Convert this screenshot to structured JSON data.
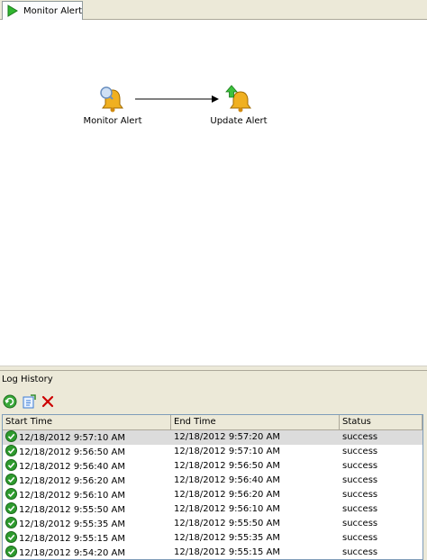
{
  "tab": {
    "label": "Monitor Alert",
    "icon": "play-arrow-icon"
  },
  "workflow": {
    "nodes": [
      {
        "label": "Monitor Alert",
        "icon": "bell-magnifier-icon"
      },
      {
        "label": "Update Alert",
        "icon": "bell-up-arrow-icon"
      }
    ]
  },
  "log": {
    "title": "Log History",
    "toolbar": [
      {
        "name": "refresh-icon",
        "color": "#2e8b2e"
      },
      {
        "name": "export-icon",
        "color": "#3a7bd5"
      },
      {
        "name": "delete-icon",
        "color": "#cc0000"
      }
    ],
    "columns": [
      "Start Time",
      "End Time",
      "Status"
    ],
    "rows": [
      {
        "start": "12/18/2012 9:57:10 AM",
        "end": "12/18/2012 9:57:20 AM",
        "status": "success"
      },
      {
        "start": "12/18/2012 9:56:50 AM",
        "end": "12/18/2012 9:57:10 AM",
        "status": "success"
      },
      {
        "start": "12/18/2012 9:56:40 AM",
        "end": "12/18/2012 9:56:50 AM",
        "status": "success"
      },
      {
        "start": "12/18/2012 9:56:20 AM",
        "end": "12/18/2012 9:56:40 AM",
        "status": "success"
      },
      {
        "start": "12/18/2012 9:56:10 AM",
        "end": "12/18/2012 9:56:20 AM",
        "status": "success"
      },
      {
        "start": "12/18/2012 9:55:50 AM",
        "end": "12/18/2012 9:56:10 AM",
        "status": "success"
      },
      {
        "start": "12/18/2012 9:55:35 AM",
        "end": "12/18/2012 9:55:50 AM",
        "status": "success"
      },
      {
        "start": "12/18/2012 9:55:15 AM",
        "end": "12/18/2012 9:55:35 AM",
        "status": "success"
      },
      {
        "start": "12/18/2012 9:54:20 AM",
        "end": "12/18/2012 9:55:15 AM",
        "status": "success"
      }
    ],
    "selected_row": 0
  },
  "colors": {
    "chrome": "#ece9d8",
    "selected_row": "#dcdcdc",
    "success": "#2e9b2e",
    "bell": "#e8a317"
  }
}
